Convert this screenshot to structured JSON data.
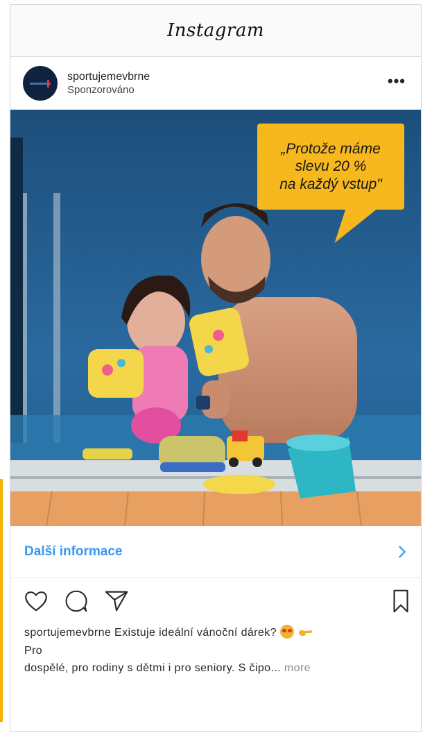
{
  "app": {
    "title": "Instagram"
  },
  "post": {
    "account": "sportujemevbrne",
    "sponsored_label": "Sponzorováno",
    "options_glyph": "•••",
    "image": {
      "description_icon": "photo-pool-father-daughter",
      "speech_bubble": {
        "line1": "„Protože máme",
        "line2": "slevu 20 %",
        "line3": "na každý vstup\""
      }
    },
    "cta": {
      "label": "Další informace",
      "icon": "chevron-right-icon"
    },
    "actions": {
      "like_icon": "heart-icon",
      "comment_icon": "comment-icon",
      "share_icon": "send-icon",
      "save_icon": "bookmark-icon"
    },
    "caption": {
      "user": "sportujemevbrne",
      "text_line1": "Existuje ideální vánoční dárek?",
      "text_line1b": "Pro",
      "text_line2": "dospělé, pro rodiny s dětmi i pro seniory. S čipo...",
      "more_label": "more",
      "emoji": [
        "heart-eyes-emoji",
        "pointing-hand-emoji"
      ]
    }
  },
  "colors": {
    "link_blue": "#3897f0",
    "bubble_yellow": "#f6b81d",
    "accent_bar": "#f5b400",
    "text": "#262626",
    "muted": "#8e8e8e"
  }
}
